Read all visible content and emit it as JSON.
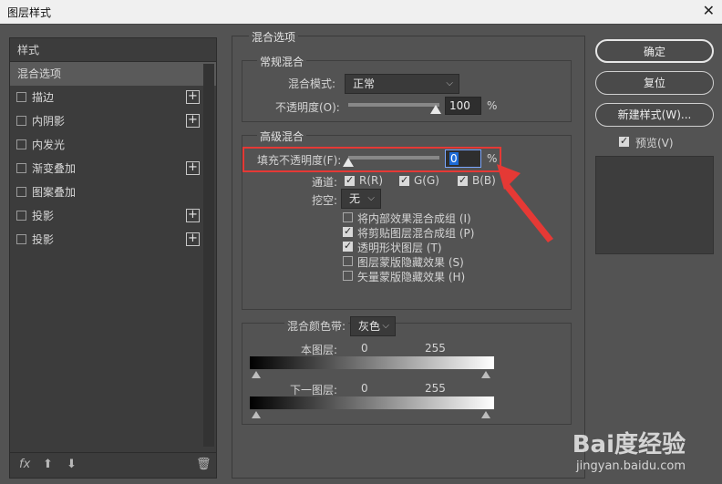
{
  "window": {
    "title": "图层样式"
  },
  "left_panel": {
    "header": "样式",
    "items": [
      {
        "label": "混合选项",
        "selected": true,
        "checkbox": false,
        "plus": false
      },
      {
        "label": "描边",
        "checkbox": true,
        "plus": true
      },
      {
        "label": "内阴影",
        "checkbox": true,
        "plus": true
      },
      {
        "label": "内发光",
        "checkbox": true,
        "plus": false
      },
      {
        "label": "渐变叠加",
        "checkbox": true,
        "plus": true
      },
      {
        "label": "图案叠加",
        "checkbox": true,
        "plus": false
      },
      {
        "label": "投影",
        "checkbox": true,
        "plus": true
      },
      {
        "label": "投影",
        "checkbox": true,
        "plus": true
      }
    ],
    "footer": {
      "fx": "fx",
      "up": "⬆",
      "down": "⬇",
      "trash": "🗑"
    }
  },
  "blend_options": {
    "section_title": "混合选项",
    "general": {
      "title": "常规混合",
      "mode_label": "混合模式:",
      "mode_value": "正常",
      "opacity_label": "不透明度(O):",
      "opacity_value": "100",
      "opacity_unit": "%"
    },
    "advanced": {
      "title": "高级混合",
      "fill_label": "填充不透明度(F):",
      "fill_value": "0",
      "fill_unit": "%",
      "channels_label": "通道:",
      "channels": [
        "R(R)",
        "G(G)",
        "B(B)"
      ],
      "knockout_label": "挖空:",
      "knockout_value": "无",
      "options": [
        {
          "label": "将内部效果混合成组 (I)",
          "checked": false
        },
        {
          "label": "将剪贴图层混合成组 (P)",
          "checked": true
        },
        {
          "label": "透明形状图层 (T)",
          "checked": true
        },
        {
          "label": "图层蒙版隐藏效果 (S)",
          "checked": false
        },
        {
          "label": "矢量蒙版隐藏效果 (H)",
          "checked": false
        }
      ]
    },
    "blend_if": {
      "label": "混合颜色带:",
      "value": "灰色",
      "this_layer": "本图层:",
      "underlying": "下一图层:",
      "min": "0",
      "max": "255"
    }
  },
  "buttons": {
    "ok": "确定",
    "reset": "复位",
    "new_style": "新建样式(W)...",
    "preview": "预览(V)"
  },
  "watermark": {
    "brand": "Bai度经验",
    "url": "jingyan.baidu.com"
  }
}
